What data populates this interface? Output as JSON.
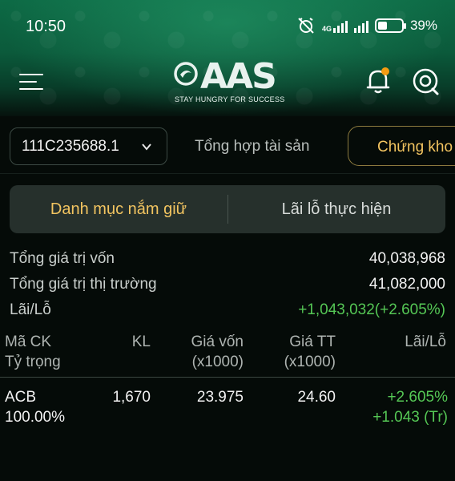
{
  "status_bar": {
    "time": "10:50",
    "network": "4G",
    "battery": "39%",
    "battery_level": 0.39
  },
  "header": {
    "logo_text": "AAS",
    "slogan": "STAY HUNGRY FOR SUCCESS",
    "icons": [
      "menu-icon",
      "bell-icon",
      "support-icon"
    ]
  },
  "account": {
    "selected": "111C235688.1"
  },
  "tabs": {
    "overview": "Tổng hợp tài sản",
    "stocks": "Chứng kho"
  },
  "segment": {
    "held": "Danh mục nắm giữ",
    "realized": "Lãi lỗ thực hiện"
  },
  "summary": [
    {
      "label": "Tổng giá trị vốn",
      "value": "40,038,968"
    },
    {
      "label": "Tổng giá trị thị trường",
      "value": "41,082,000"
    },
    {
      "label": "Lãi/Lỗ",
      "value": "+1,043,032(+2.605%)"
    }
  ],
  "table": {
    "headers": {
      "symbol": "Mã CK",
      "weight": "Tỷ trọng",
      "qty": "KL",
      "cost": "Giá vốn",
      "cost_unit": "(x1000)",
      "price": "Giá TT",
      "price_unit": "(x1000)",
      "pl": "Lãi/Lỗ"
    },
    "rows": [
      {
        "symbol": "ACB",
        "weight": "100.00%",
        "qty": "1,670",
        "cost": "23.975",
        "price": "24.60",
        "pl_pct": "+2.605%",
        "pl_value": "+1.043 (Tr)"
      }
    ]
  },
  "colors": {
    "accent_gold": "#f2c460",
    "profit_green": "#55c755",
    "header_green": "#0b5a3b"
  }
}
